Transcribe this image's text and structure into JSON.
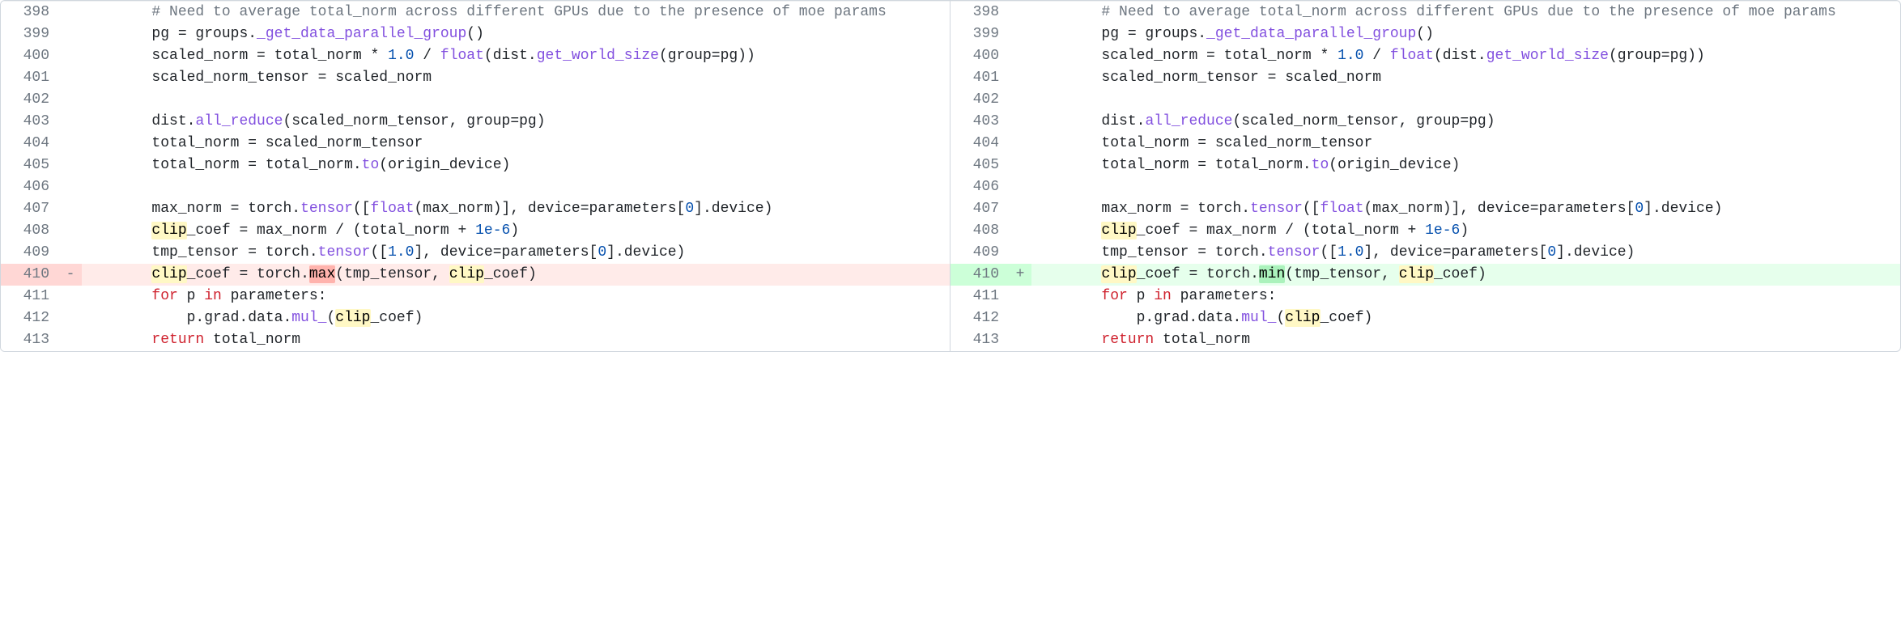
{
  "highlight_term": "clip",
  "left": [
    {
      "n": "398",
      "mk": "",
      "kind": "ctx",
      "code": "        # Need to average total_norm across different GPUs due to the presence of moe params"
    },
    {
      "n": "399",
      "mk": "",
      "kind": "ctx",
      "code": "        pg = groups._get_data_parallel_group()"
    },
    {
      "n": "400",
      "mk": "",
      "kind": "ctx",
      "code": "        scaled_norm = total_norm * 1.0 / float(dist.get_world_size(group=pg))"
    },
    {
      "n": "401",
      "mk": "",
      "kind": "ctx",
      "code": "        scaled_norm_tensor = scaled_norm"
    },
    {
      "n": "402",
      "mk": "",
      "kind": "ctx",
      "code": ""
    },
    {
      "n": "403",
      "mk": "",
      "kind": "ctx",
      "code": "        dist.all_reduce(scaled_norm_tensor, group=pg)"
    },
    {
      "n": "404",
      "mk": "",
      "kind": "ctx",
      "code": "        total_norm = scaled_norm_tensor"
    },
    {
      "n": "405",
      "mk": "",
      "kind": "ctx",
      "code": "        total_norm = total_norm.to(origin_device)"
    },
    {
      "n": "406",
      "mk": "",
      "kind": "ctx",
      "code": ""
    },
    {
      "n": "407",
      "mk": "",
      "kind": "ctx",
      "code": "        max_norm = torch.tensor([float(max_norm)], device=parameters[0].device)"
    },
    {
      "n": "408",
      "mk": "",
      "kind": "ctx",
      "code": "        clip_coef = max_norm / (total_norm + 1e-6)"
    },
    {
      "n": "409",
      "mk": "",
      "kind": "ctx",
      "code": "        tmp_tensor = torch.tensor([1.0], device=parameters[0].device)"
    },
    {
      "n": "410",
      "mk": "-",
      "kind": "del",
      "code": "        clip_coef = torch.max(tmp_tensor, clip_coef)",
      "word_del": "max"
    },
    {
      "n": "411",
      "mk": "",
      "kind": "ctx",
      "code": "        for p in parameters:"
    },
    {
      "n": "412",
      "mk": "",
      "kind": "ctx",
      "code": "            p.grad.data.mul_(clip_coef)"
    },
    {
      "n": "413",
      "mk": "",
      "kind": "ctx",
      "code": "        return total_norm"
    }
  ],
  "right": [
    {
      "n": "398",
      "mk": "",
      "kind": "ctx",
      "code": "        # Need to average total_norm across different GPUs due to the presence of moe params"
    },
    {
      "n": "399",
      "mk": "",
      "kind": "ctx",
      "code": "        pg = groups._get_data_parallel_group()"
    },
    {
      "n": "400",
      "mk": "",
      "kind": "ctx",
      "code": "        scaled_norm = total_norm * 1.0 / float(dist.get_world_size(group=pg))"
    },
    {
      "n": "401",
      "mk": "",
      "kind": "ctx",
      "code": "        scaled_norm_tensor = scaled_norm"
    },
    {
      "n": "402",
      "mk": "",
      "kind": "ctx",
      "code": ""
    },
    {
      "n": "403",
      "mk": "",
      "kind": "ctx",
      "code": "        dist.all_reduce(scaled_norm_tensor, group=pg)"
    },
    {
      "n": "404",
      "mk": "",
      "kind": "ctx",
      "code": "        total_norm = scaled_norm_tensor"
    },
    {
      "n": "405",
      "mk": "",
      "kind": "ctx",
      "code": "        total_norm = total_norm.to(origin_device)"
    },
    {
      "n": "406",
      "mk": "",
      "kind": "ctx",
      "code": ""
    },
    {
      "n": "407",
      "mk": "",
      "kind": "ctx",
      "code": "        max_norm = torch.tensor([float(max_norm)], device=parameters[0].device)"
    },
    {
      "n": "408",
      "mk": "",
      "kind": "ctx",
      "code": "        clip_coef = max_norm / (total_norm + 1e-6)"
    },
    {
      "n": "409",
      "mk": "",
      "kind": "ctx",
      "code": "        tmp_tensor = torch.tensor([1.0], device=parameters[0].device)"
    },
    {
      "n": "410",
      "mk": "+",
      "kind": "add",
      "code": "        clip_coef = torch.min(tmp_tensor, clip_coef)",
      "word_add": "min"
    },
    {
      "n": "411",
      "mk": "",
      "kind": "ctx",
      "code": "        for p in parameters:"
    },
    {
      "n": "412",
      "mk": "",
      "kind": "ctx",
      "code": "            p.grad.data.mul_(clip_coef)"
    },
    {
      "n": "413",
      "mk": "",
      "kind": "ctx",
      "code": "        return total_norm"
    }
  ]
}
